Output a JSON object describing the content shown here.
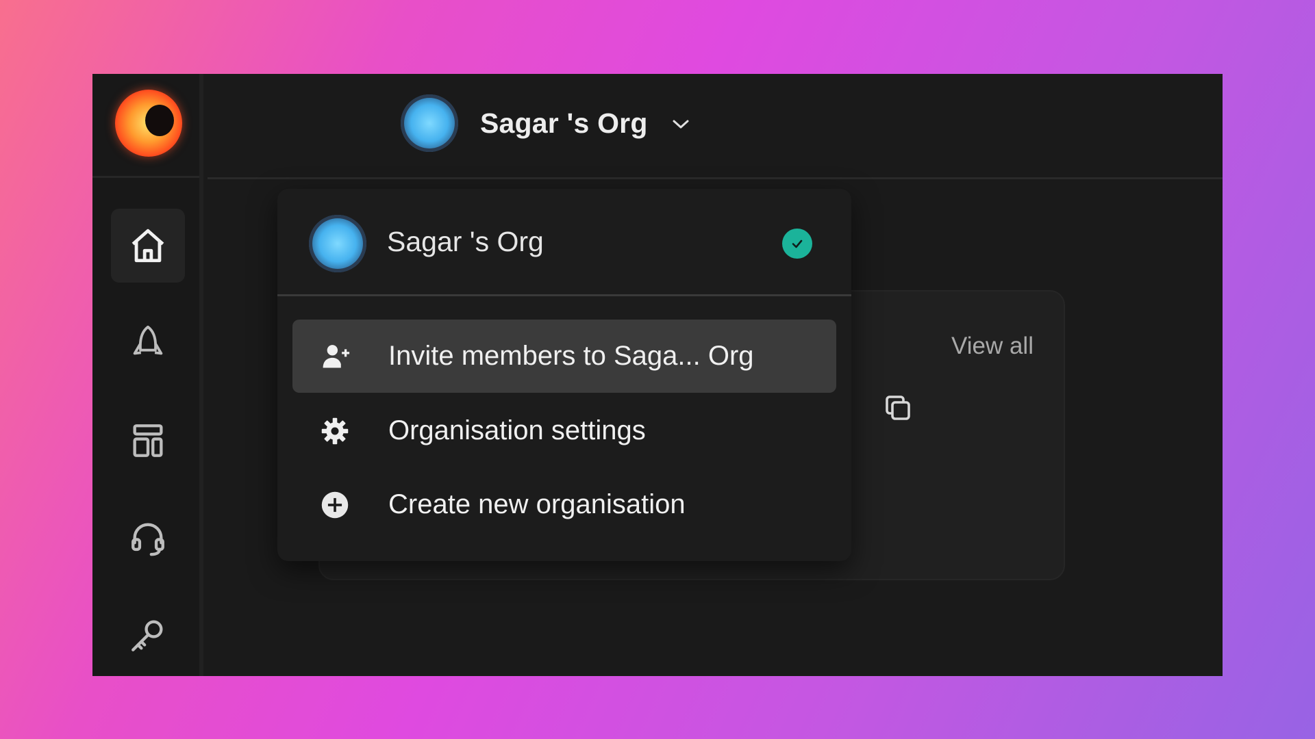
{
  "header": {
    "org_name": "Sagar 's Org"
  },
  "sidebar": {
    "items": [
      {
        "icon": "home-icon",
        "active": true
      },
      {
        "icon": "rocket-icon",
        "active": false
      },
      {
        "icon": "layout-icon",
        "active": false
      },
      {
        "icon": "headset-icon",
        "active": false
      },
      {
        "icon": "key-icon",
        "active": false
      }
    ]
  },
  "card": {
    "view_all_label": "View all"
  },
  "dropdown": {
    "current_org": "Sagar 's Org",
    "items": [
      {
        "label": "Invite members to Saga... Org",
        "icon": "add-user-icon",
        "highlighted": true
      },
      {
        "label": "Organisation settings",
        "icon": "gear-icon",
        "highlighted": false
      },
      {
        "label": "Create new organisation",
        "icon": "plus-circle-icon",
        "highlighted": false
      }
    ]
  },
  "colors": {
    "check_badge": "#1bb39a",
    "panel_bg": "#1a1a1a",
    "highlight_bg": "#3b3b3b"
  }
}
